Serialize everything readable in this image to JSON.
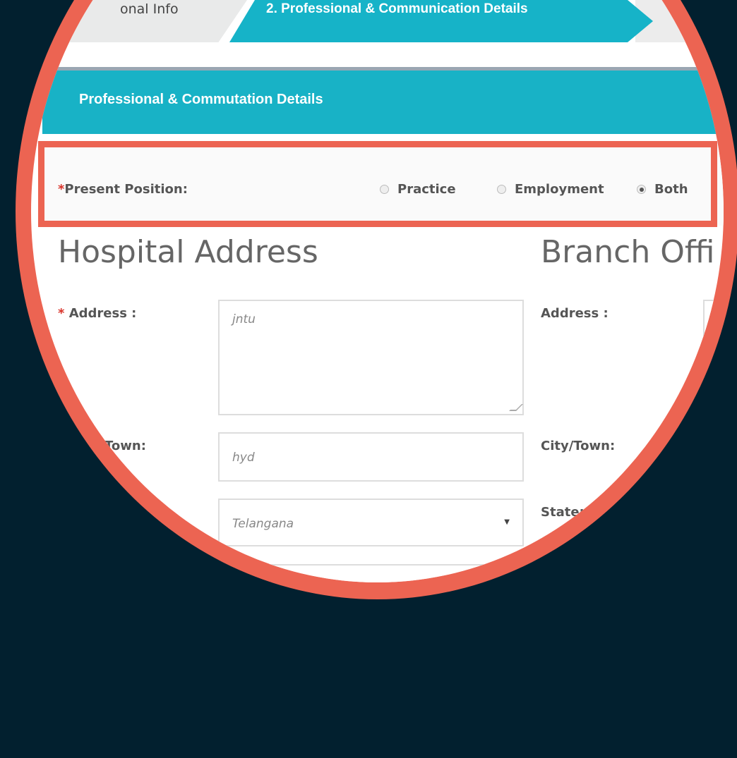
{
  "tabs": [
    {
      "label": "onal Info"
    },
    {
      "label": "2. Professional & Communication Details"
    }
  ],
  "section": {
    "title": "Professional & Commutation Details"
  },
  "present_position": {
    "label": "Present Position:",
    "required_mark": "*",
    "options": [
      {
        "label": "Practice",
        "selected": false
      },
      {
        "label": "Employment",
        "selected": false
      },
      {
        "label": "Both",
        "selected": true
      }
    ]
  },
  "hospital": {
    "heading": "Hospital Address",
    "address_label": "Address :",
    "address_required": "*",
    "address_value": "jntu",
    "city_label": "Town:",
    "city_value": "hyd",
    "state_value": "Telangana"
  },
  "branch": {
    "heading": "Branch Offi",
    "address_label": "Address :",
    "city_label": "City/Town:",
    "state_label": "State:"
  },
  "colors": {
    "background": "#02202f",
    "lens_ring": "#ec6452",
    "accent": "#16b3c8",
    "required": "#d9342b"
  }
}
